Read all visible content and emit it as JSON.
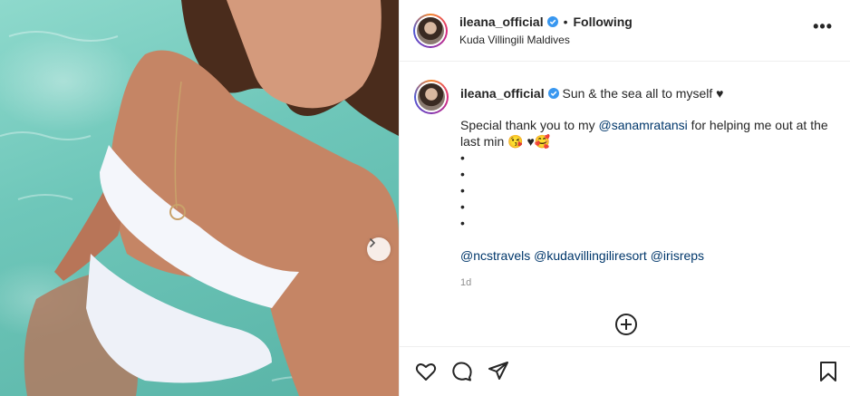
{
  "post": {
    "username": "ileana_official",
    "separator": "•",
    "follow_status": "Following",
    "location": "Kuda Villingili Maldives",
    "more_label": "•••"
  },
  "caption": {
    "username": "ileana_official",
    "line1": "Sun & the sea all to myself ♥",
    "line2_prefix": "Special thank you to my ",
    "line2_mention": "@sanamratansi",
    "line2_suffix": " for helping me out at the last min 😘 ♥🥰",
    "bullets": [
      "•",
      "•",
      "•",
      "•",
      "•"
    ],
    "tags": [
      "@ncstravels",
      "@kudavillingiliresort",
      "@irisreps"
    ],
    "timestamp": "1d"
  },
  "icons": {
    "verified": "verified-badge-icon",
    "next": "chevron-right-icon",
    "add_comment": "plus-circle-icon",
    "like": "heart-icon",
    "comment": "comment-icon",
    "share": "paper-plane-icon",
    "save": "bookmark-icon"
  },
  "colors": {
    "verified_blue": "#3897f0",
    "mention_blue": "#00376b",
    "border": "#efefef",
    "muted": "#8e8e8e"
  }
}
